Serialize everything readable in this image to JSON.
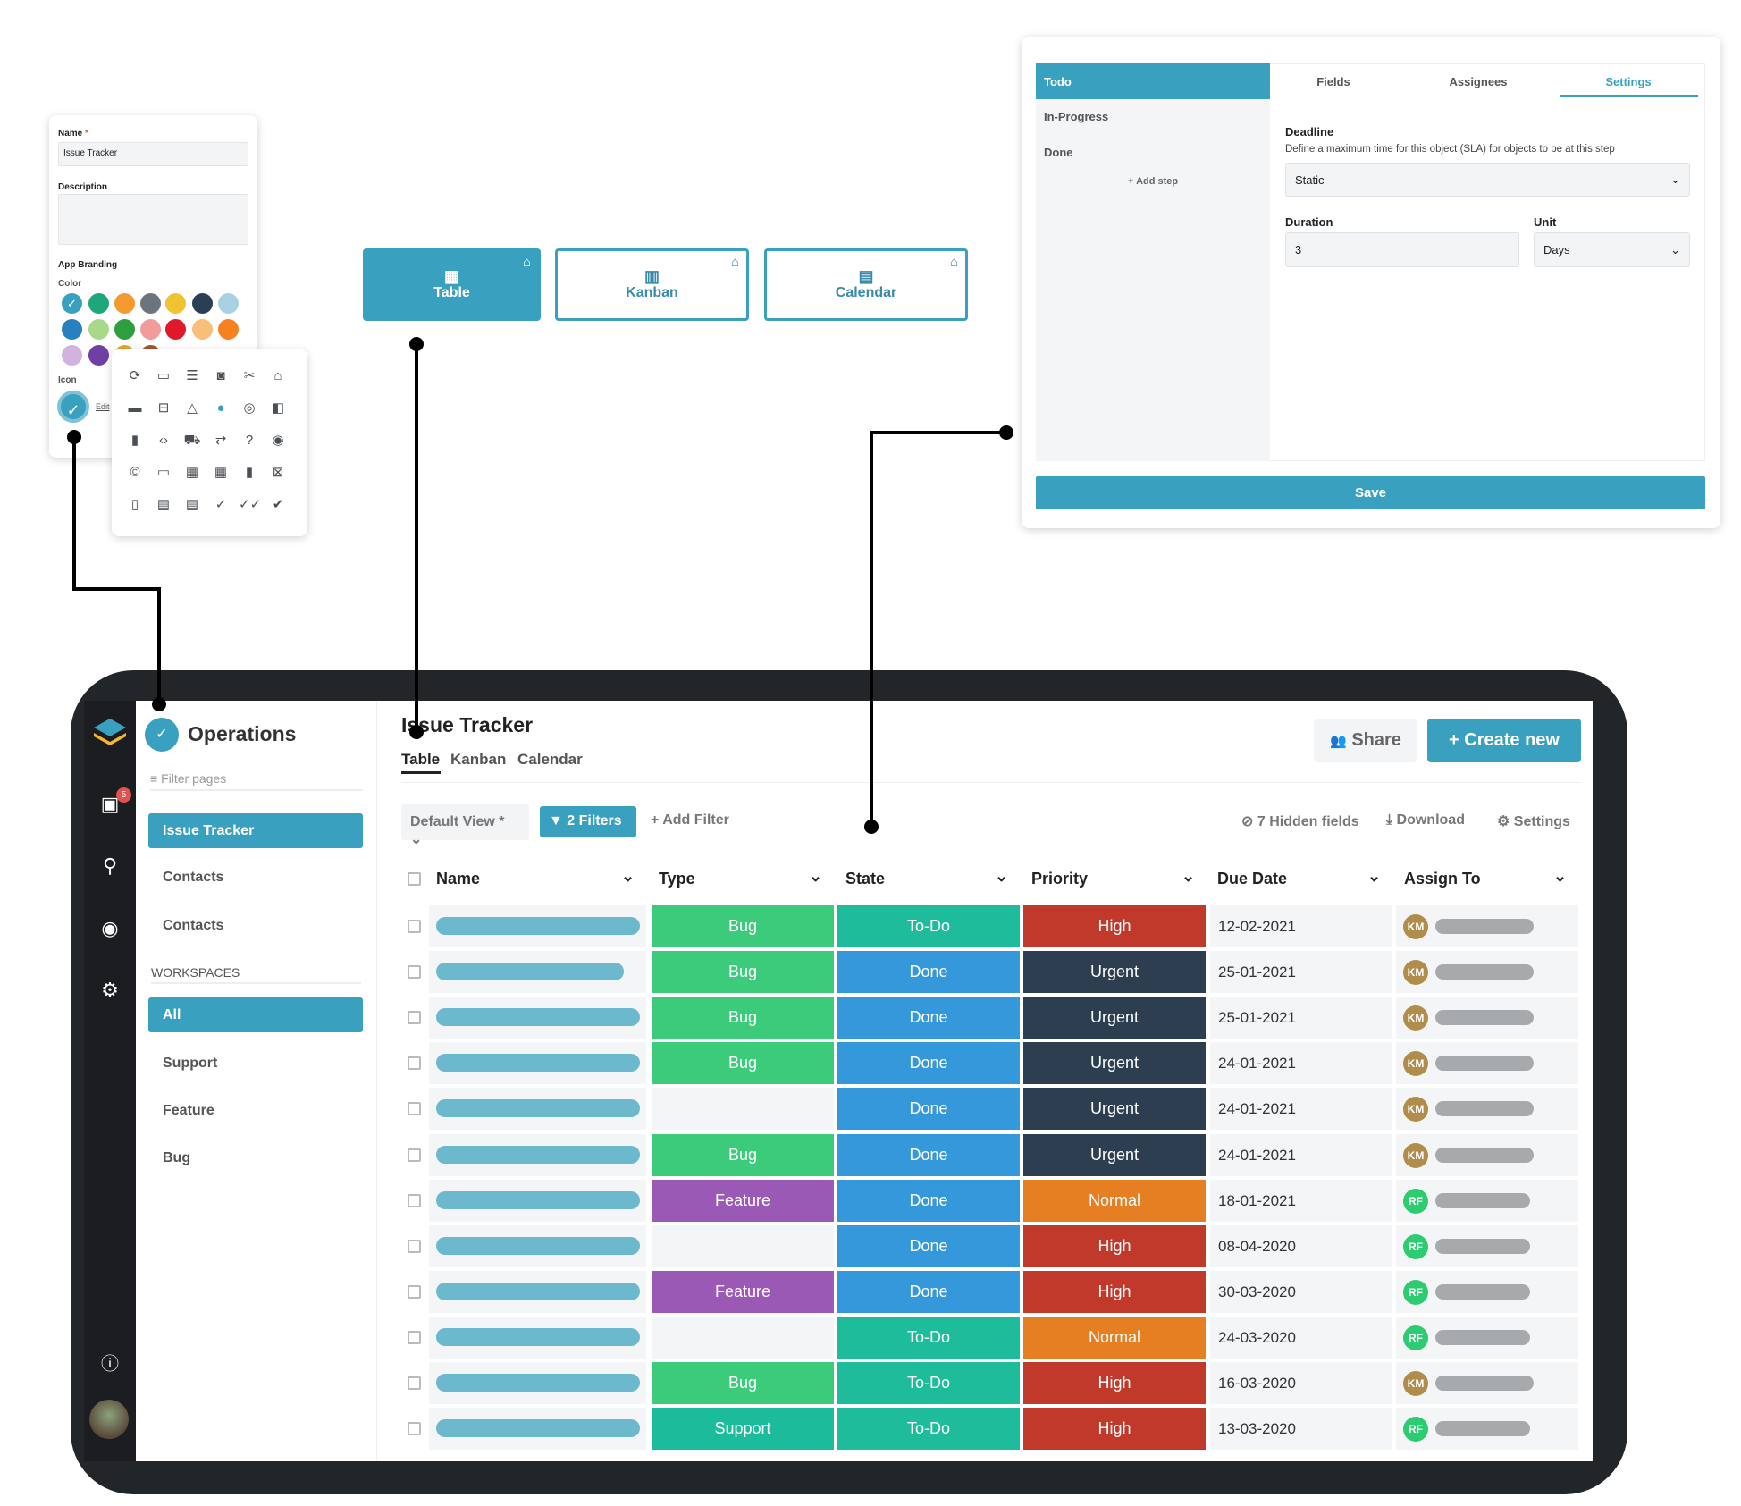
{
  "form": {
    "name_label": "Name",
    "required_mark": "*",
    "name_value": "Issue Tracker",
    "description_label": "Description",
    "branding_label": "App Branding",
    "color_label": "Color",
    "icon_label": "Icon",
    "edit_link": "Edit",
    "colors": [
      "#3aa0bf",
      "#1fa67a",
      "#f29a2e",
      "#6c757d",
      "#f1c232",
      "#2c3e56",
      "#a9d0e3",
      "#2a7fbf",
      "#a8d98a",
      "#2e9e3e",
      "#f19b9b",
      "#e0192a",
      "#f9be7a",
      "#f7801f",
      "#d1b3de",
      "#6f3fa6",
      "#e3a531",
      "#a0562b"
    ],
    "selected_color": "#3aa0bf"
  },
  "icon_picker": {
    "icons": [
      "refresh-icon",
      "calendar-icon",
      "bars-icon",
      "camera-icon",
      "scissors-icon",
      "gift-icon",
      "presentation-icon",
      "briefcase-icon",
      "triangle-icon",
      "check-circle-filled-icon",
      "check-circle-icon",
      "sidebar-icon",
      "book-icon",
      "code-icon",
      "car-icon",
      "compress-icon",
      "question-icon",
      "audio-icon",
      "copyright-icon",
      "credit-card-icon",
      "dashboard-icon",
      "calendar-alt-icon",
      "trash-icon",
      "trash-x-icon",
      "trash-outline-icon",
      "file-icon",
      "server-icon",
      "check-icon",
      "double-check-icon",
      "check-bold-icon"
    ],
    "glyphs": [
      "⟳",
      "▭",
      "☰",
      "◙",
      "✂",
      "⌂",
      "▬",
      "⊟",
      "△",
      "●",
      "◎",
      "◧",
      "▮",
      "‹›",
      "⛟",
      "⇄",
      "?",
      "◉",
      "©",
      "▭",
      "▦",
      "▦",
      "▮",
      "⊠",
      "▯",
      "▤",
      "▤",
      "✓",
      "✓✓",
      "✔"
    ]
  },
  "views": [
    {
      "label": "Table",
      "icon": "grid-icon",
      "active": true
    },
    {
      "label": "Kanban",
      "icon": "columns-icon",
      "active": false
    },
    {
      "label": "Calendar",
      "icon": "calendar-icon",
      "active": false
    }
  ],
  "workflow": {
    "steps": [
      "Todo",
      "In-Progress",
      "Done"
    ],
    "add_step": "+ Add step",
    "tabs": [
      "Fields",
      "Assignees",
      "Settings"
    ],
    "active_tab": "Settings",
    "deadline_label": "Deadline",
    "deadline_desc": "Define a maximum time for this object (SLA) for objects to be at this step",
    "deadline_type": "Static",
    "duration_label": "Duration",
    "duration_value": "3",
    "unit_label": "Unit",
    "unit_value": "Days",
    "save": "Save"
  },
  "app": {
    "inbox_badge": "5",
    "sidebar": {
      "title": "Operations",
      "filter_placeholder": "Filter pages",
      "pages": [
        "Issue Tracker",
        "Contacts",
        "Contacts"
      ],
      "workspaces_label": "WORKSPACES",
      "workspaces": [
        "All",
        "Support",
        "Feature",
        "Bug"
      ]
    },
    "header": {
      "title": "Issue Tracker",
      "tabs": [
        "Table",
        "Kanban",
        "Calendar"
      ],
      "share": "Share",
      "create": "+ Create new"
    },
    "toolbar": {
      "view": "Default View *",
      "filters": "2  Filters",
      "add_filter": "+ Add Filter",
      "hidden": "7 Hidden fields",
      "download": "Download",
      "settings": "Settings"
    },
    "columns": [
      "Name",
      "Type",
      "State",
      "Priority",
      "Due Date",
      "Assign To"
    ],
    "colors": {
      "Bug": "#3ccb7a",
      "Feature": "#9b59b6",
      "Support": "#1abc9c",
      "To-Do": "#1fbc9c",
      "Done": "#3498db",
      "High": "#c0392b",
      "Urgent": "#2c3e50",
      "Normal": "#e67e22",
      "KM": "#b08d4a",
      "RF": "#2ecc71"
    },
    "rows": [
      {
        "type": "Bug",
        "state": "To-Do",
        "priority": "High",
        "due": "12-02-2021",
        "assignee": "KM"
      },
      {
        "type": "Bug",
        "state": "Done",
        "priority": "Urgent",
        "due": "25-01-2021",
        "assignee": "KM"
      },
      {
        "type": "Bug",
        "state": "Done",
        "priority": "Urgent",
        "due": "25-01-2021",
        "assignee": "KM"
      },
      {
        "type": "Bug",
        "state": "Done",
        "priority": "Urgent",
        "due": "24-01-2021",
        "assignee": "KM"
      },
      {
        "type": "",
        "state": "Done",
        "priority": "Urgent",
        "due": "24-01-2021",
        "assignee": "KM"
      },
      {
        "type": "Bug",
        "state": "Done",
        "priority": "Urgent",
        "due": "24-01-2021",
        "assignee": "KM"
      },
      {
        "type": "Feature",
        "state": "Done",
        "priority": "Normal",
        "due": "18-01-2021",
        "assignee": "RF"
      },
      {
        "type": "",
        "state": "Done",
        "priority": "High",
        "due": "08-04-2020",
        "assignee": "RF"
      },
      {
        "type": "Feature",
        "state": "Done",
        "priority": "High",
        "due": "30-03-2020",
        "assignee": "RF"
      },
      {
        "type": "",
        "state": "To-Do",
        "priority": "Normal",
        "due": "24-03-2020",
        "assignee": "RF"
      },
      {
        "type": "Bug",
        "state": "To-Do",
        "priority": "High",
        "due": "16-03-2020",
        "assignee": "KM"
      },
      {
        "type": "Support",
        "state": "To-Do",
        "priority": "High",
        "due": "13-03-2020",
        "assignee": "RF"
      }
    ]
  }
}
